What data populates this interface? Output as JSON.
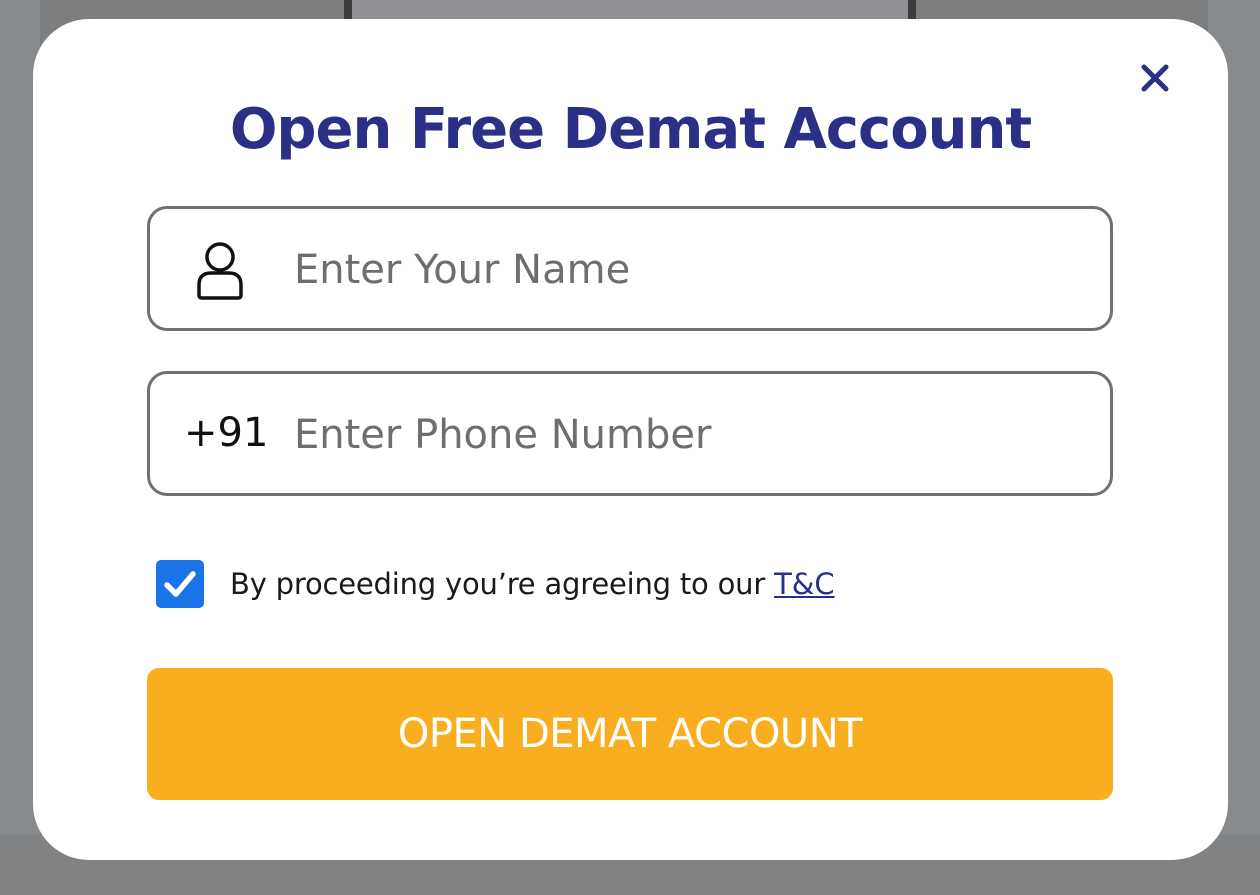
{
  "modal": {
    "title": "Open Free Demat Account",
    "close_icon": "close-icon",
    "name_field": {
      "icon": "user-icon",
      "placeholder": "Enter Your Name",
      "value": ""
    },
    "phone_field": {
      "prefix": "+91",
      "placeholder": "Enter Phone Number",
      "value": ""
    },
    "consent": {
      "checked": true,
      "text": "By proceeding you’re agreeing to our",
      "link_label": "T&C"
    },
    "submit_label": "OPEN DEMAT ACCOUNT"
  },
  "colors": {
    "title": "#2b2f86",
    "accent_button": "#f9ae1f",
    "checkbox": "#1b73e8",
    "field_border": "#707070"
  }
}
